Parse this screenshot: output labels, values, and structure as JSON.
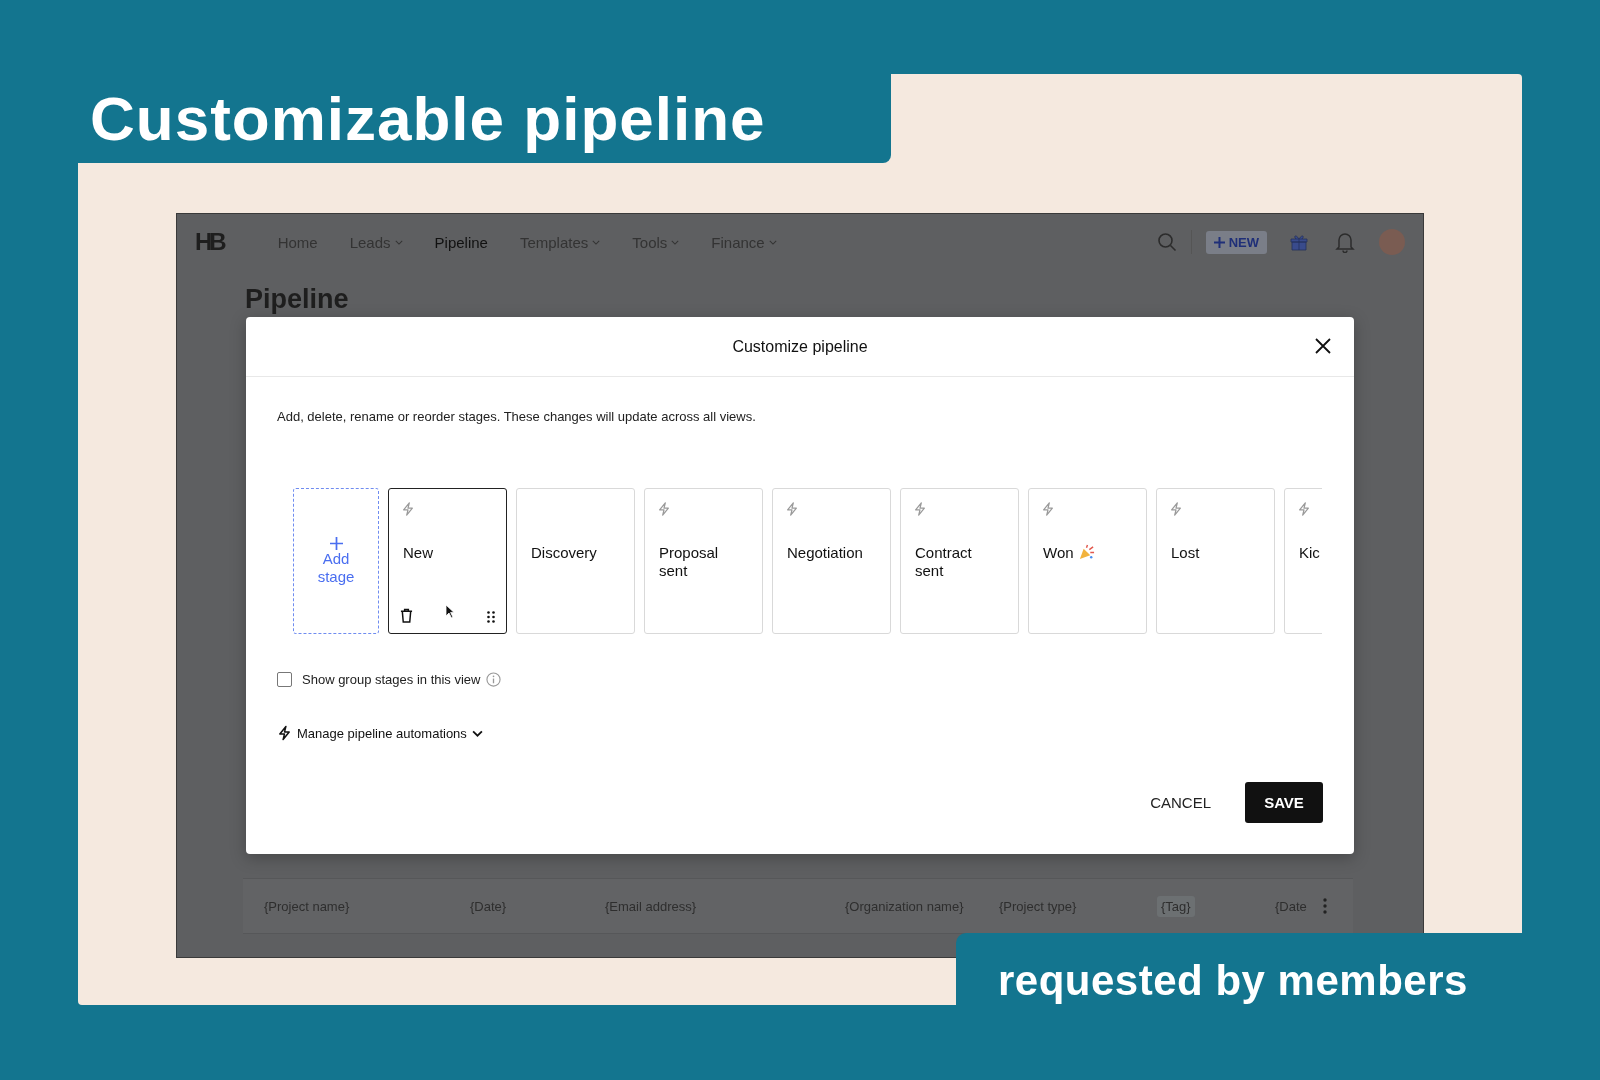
{
  "banner": {
    "title": "Customizable pipeline",
    "tagline": "requested by members"
  },
  "nav": {
    "logo": "HB",
    "items": [
      {
        "label": "Home",
        "dropdown": false,
        "selected": false
      },
      {
        "label": "Leads",
        "dropdown": true,
        "selected": false
      },
      {
        "label": "Pipeline",
        "dropdown": false,
        "selected": true
      },
      {
        "label": "Templates",
        "dropdown": true,
        "selected": false
      },
      {
        "label": "Tools",
        "dropdown": true,
        "selected": false
      },
      {
        "label": "Finance",
        "dropdown": true,
        "selected": false
      }
    ],
    "new_button": "NEW"
  },
  "page_title": "Pipeline",
  "table_row": [
    "{Project name}",
    "{Date}",
    "{Email address}",
    "{Organization name}",
    "{Project type}",
    "{Tag}",
    "{Date"
  ],
  "dialog": {
    "title": "Customize pipeline",
    "description": "Add, delete, rename or reorder stages. These changes will update across all views.",
    "add_stage": "Add stage",
    "stages": [
      {
        "name": "New",
        "automation": true,
        "selected": true,
        "celebration": false
      },
      {
        "name": "Discovery",
        "automation": false,
        "selected": false,
        "celebration": false
      },
      {
        "name": "Proposal sent",
        "automation": true,
        "selected": false,
        "celebration": false
      },
      {
        "name": "Negotiation",
        "automation": true,
        "selected": false,
        "celebration": false
      },
      {
        "name": "Contract sent",
        "automation": true,
        "selected": false,
        "celebration": false
      },
      {
        "name": "Won",
        "automation": true,
        "selected": false,
        "celebration": true
      },
      {
        "name": "Lost",
        "automation": true,
        "selected": false,
        "celebration": false
      },
      {
        "name": "Kic",
        "automation": true,
        "selected": false,
        "celebration": false
      }
    ],
    "group_stages": {
      "label": "Show group stages in this view",
      "checked": false
    },
    "automations": "Manage pipeline automations",
    "cancel": "CANCEL",
    "save": "SAVE"
  }
}
